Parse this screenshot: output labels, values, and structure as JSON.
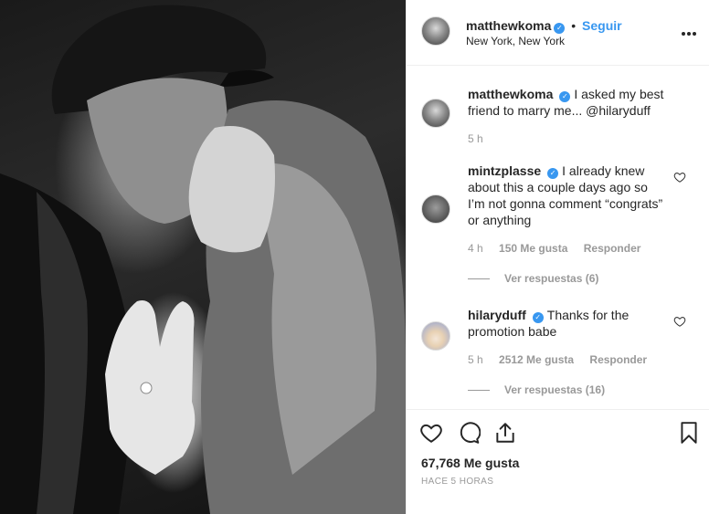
{
  "post": {
    "author": "matthewkoma",
    "follow_label": "Seguir",
    "separator": "•",
    "location": "New York, New York",
    "more_label": "•••"
  },
  "caption": {
    "username": "matthewkoma",
    "text": "I asked my best friend to marry me... @hilaryduff",
    "time": "5 h"
  },
  "comments": [
    {
      "username": "mintzplasse",
      "text": "I already knew about this a couple days ago so I’m not gonna comment “congrats” or anything",
      "time": "4 h",
      "likes": "150 Me gusta",
      "reply_label": "Responder",
      "view_replies": "Ver respuestas (6)"
    },
    {
      "username": "hilaryduff",
      "text": "Thanks for the promotion babe",
      "time": "5 h",
      "likes": "2512 Me gusta",
      "reply_label": "Responder",
      "view_replies": "Ver respuestas (16)"
    }
  ],
  "actions": {
    "likes_count": "67,768 Me gusta",
    "posted_ago": "HACE 5 HORAS"
  },
  "colors": {
    "link_blue": "#3897f0",
    "text": "#262626",
    "muted": "#999999",
    "divider": "#efefef"
  },
  "icons": [
    "heart-icon",
    "comment-icon",
    "share-icon",
    "bookmark-icon",
    "verified-badge-icon",
    "more-options-icon"
  ]
}
